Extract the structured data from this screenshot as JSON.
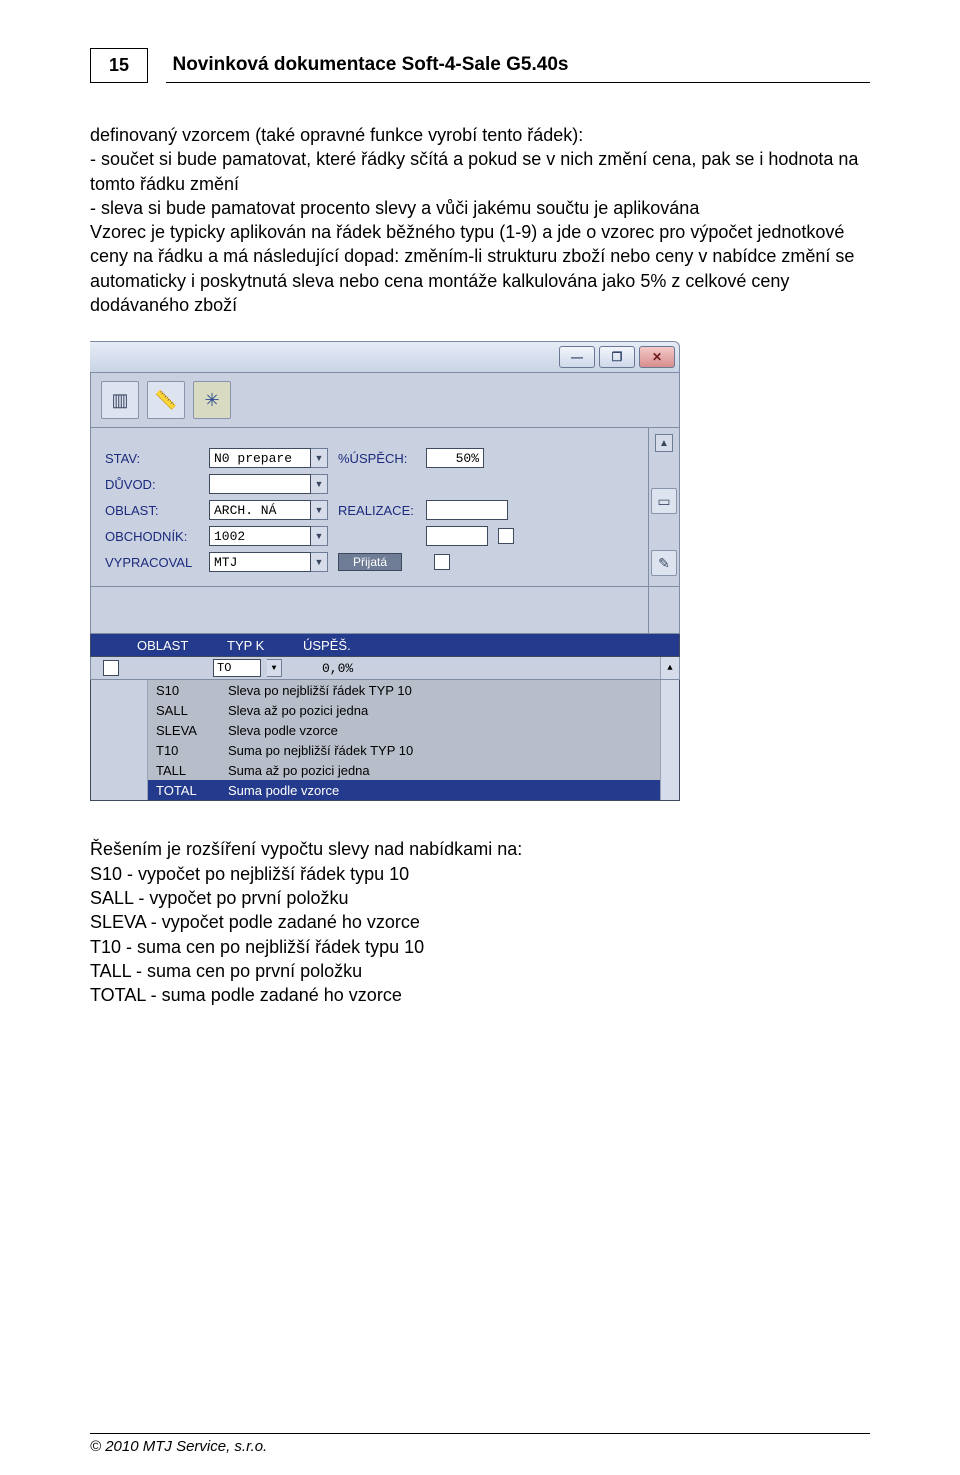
{
  "header": {
    "page_number": "15",
    "title": "Novinková dokumentace Soft-4-Sale G5.40s"
  },
  "paragraph1": "definovaný vzorcem (také opravné funkce vyrobí tento řádek):\n- součet si bude pamatovat, které řádky sčítá a pokud se v nich změní cena, pak se i hodnota na tomto řádku změní\n- sleva si bude pamatovat procento slevy a vůči jakému součtu je aplikována\nVzorec je typicky aplikován na řádek běžného typu (1-9) a jde o vzorec pro výpočet jednotkové ceny na řádku a má následující dopad: změním-li strukturu zboží nebo ceny v nabídce změní se automaticky i poskytnutá sleva nebo cena montáže kalkulována jako 5% z celkové ceny dodávaného zboží",
  "paragraph2": "Řešením je rozšíření vypočtu slevy nad nabídkami na:\nS10 - vypočet po nejbližší řádek typu 10\nSALL - vypočet po první položku\nSLEVA - vypočet podle zadané ho vzorce\nT10 - suma cen po nejbližší řádek typu 10\nTALL - suma cen po první položku\nTOTAL - suma podle zadané ho vzorce",
  "screenshot": {
    "win_buttons": {
      "min": "—",
      "max": "❐",
      "close": "✕"
    },
    "form": {
      "rows": [
        {
          "label": "STAV:",
          "value": "N0 prepare",
          "label2": "%ÚSPĚCH:",
          "value2": "50%"
        },
        {
          "label": "DŮVOD:",
          "value": ""
        },
        {
          "label": "OBLAST:",
          "value": "ARCH. NÁ",
          "label2": "REALIZACE:"
        },
        {
          "label": "OBCHODNÍK:",
          "value": "1002"
        },
        {
          "label": "VYPRACOVAL",
          "value": "MTJ",
          "button": "Přijatá"
        }
      ]
    },
    "list_header": {
      "c1": "OBLAST",
      "c2": "TYP K",
      "c3": "ÚSPĚŠ."
    },
    "first_row": {
      "field": "TO",
      "value": "0,0%"
    },
    "dropdown": [
      {
        "code": "S10",
        "desc": "Sleva po nejbližší řádek TYP 10"
      },
      {
        "code": "SALL",
        "desc": "Sleva až po pozici jedna"
      },
      {
        "code": "SLEVA",
        "desc": "Sleva podle vzorce"
      },
      {
        "code": "T10",
        "desc": "Suma po nejbližší řádek TYP 10"
      },
      {
        "code": "TALL",
        "desc": "Suma až po pozici jedna"
      },
      {
        "code": "TOTAL",
        "desc": "Suma podle vzorce",
        "selected": true
      }
    ]
  },
  "footer": "© 2010 MTJ Service, s.r.o."
}
